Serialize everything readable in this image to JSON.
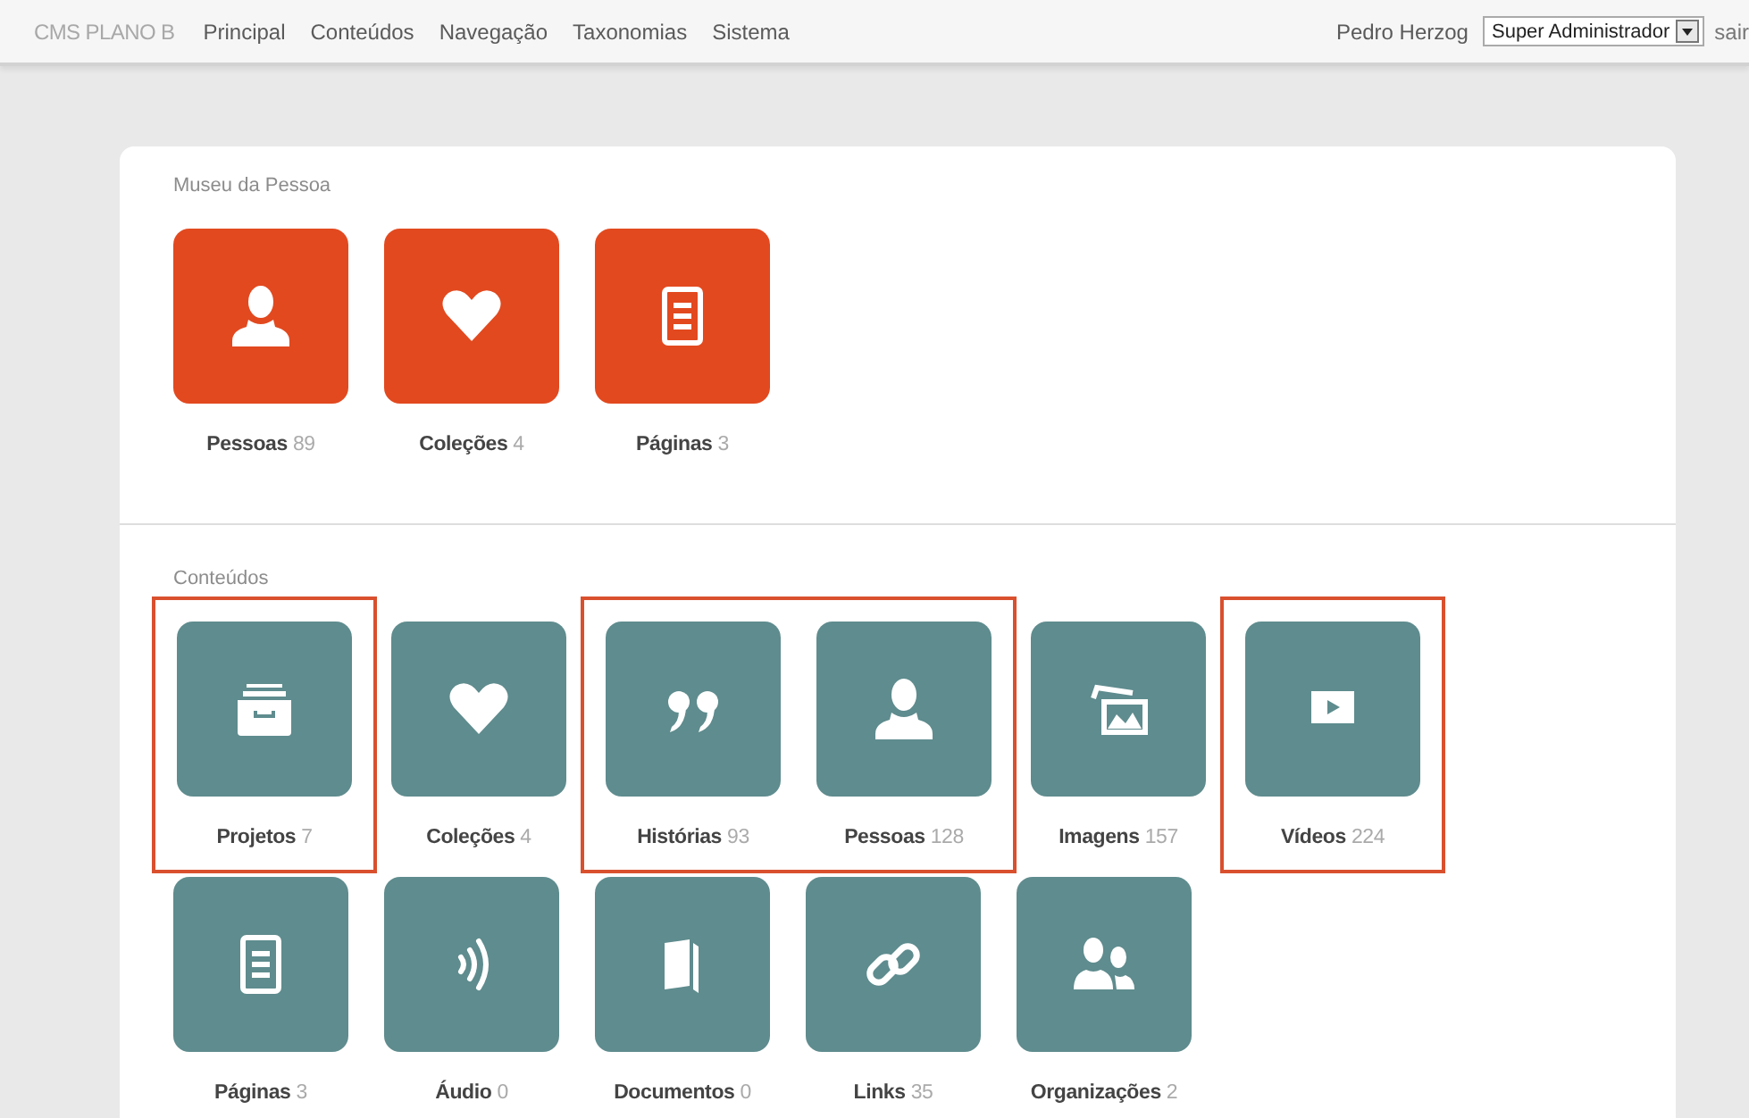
{
  "top_bar": {
    "brand": "CMS PLANO B",
    "menu": [
      "Principal",
      "Conteúdos",
      "Navegação",
      "Taxonomias",
      "Sistema"
    ],
    "user": "Pedro Herzog",
    "role_select": {
      "value": "Super Administrador"
    },
    "logout": "sair"
  },
  "sections": [
    {
      "title": "Museu da Pessoa",
      "color": "#e2491f",
      "rows": [
        [
          {
            "highlighted": false,
            "tiles": [
              {
                "kind": "person",
                "label": "Pessoas",
                "count": "89"
              },
              {
                "kind": "heart",
                "label": "Coleções",
                "count": "4"
              },
              {
                "kind": "page",
                "label": "Páginas",
                "count": "3"
              }
            ]
          }
        ]
      ]
    },
    {
      "title": "Conteúdos",
      "color": "#5f8c8e",
      "rows": [
        [
          {
            "highlighted": true,
            "tiles": [
              {
                "kind": "archive",
                "label": "Projetos",
                "count": "7"
              }
            ]
          },
          {
            "highlighted": false,
            "tiles": [
              {
                "kind": "heart",
                "label": "Coleções",
                "count": "4"
              }
            ]
          },
          {
            "highlighted": true,
            "tiles": [
              {
                "kind": "quote",
                "label": "Histórias",
                "count": "93"
              },
              {
                "kind": "person",
                "label": "Pessoas",
                "count": "128"
              }
            ]
          },
          {
            "highlighted": false,
            "tiles": [
              {
                "kind": "image",
                "label": "Imagens",
                "count": "157"
              }
            ]
          },
          {
            "highlighted": true,
            "tiles": [
              {
                "kind": "video",
                "label": "Vídeos",
                "count": "224"
              }
            ]
          }
        ],
        [
          {
            "highlighted": false,
            "tiles": [
              {
                "kind": "page",
                "label": "Páginas",
                "count": "3"
              },
              {
                "kind": "audio",
                "label": "Áudio",
                "count": "0"
              },
              {
                "kind": "book",
                "label": "Documentos",
                "count": "0"
              },
              {
                "kind": "link",
                "label": "Links",
                "count": "35"
              },
              {
                "kind": "people",
                "label": "Organizações",
                "count": "2"
              }
            ]
          }
        ]
      ]
    }
  ]
}
